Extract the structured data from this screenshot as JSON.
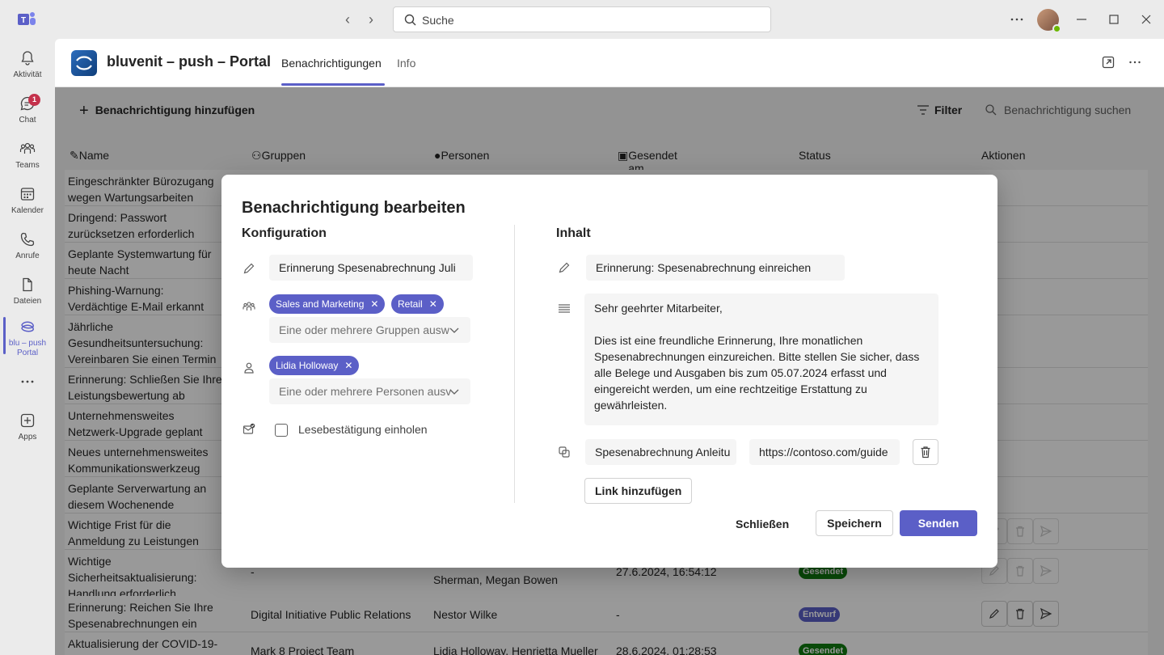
{
  "titlebar": {
    "search_placeholder": "Suche"
  },
  "rail": {
    "items": [
      {
        "label": "Aktivität",
        "icon": "bell-icon"
      },
      {
        "label": "Chat",
        "icon": "chat-icon",
        "badge": "1"
      },
      {
        "label": "Teams",
        "icon": "teams-icon"
      },
      {
        "label": "Kalender",
        "icon": "calendar-icon"
      },
      {
        "label": "Anrufe",
        "icon": "phone-icon"
      },
      {
        "label": "Dateien",
        "icon": "file-icon"
      },
      {
        "label": "blu – push Portal",
        "icon": "bluvenit-icon"
      },
      {
        "label": "Apps",
        "icon": "add-apps-icon"
      }
    ]
  },
  "app": {
    "title": "bluvenit – push – Portal",
    "tabs": [
      "Benachrichtigungen",
      "Info"
    ],
    "active_tab": "Benachrichtigungen"
  },
  "toolbar": {
    "add_label": "Benachrichtigung hinzufügen",
    "filter_label": "Filter",
    "search_placeholder": "Benachrichtigung suchen"
  },
  "table": {
    "columns": [
      "Name",
      "Gruppen",
      "Personen",
      "Gesendet am",
      "Status",
      "Aktionen"
    ],
    "rows": [
      {
        "name": "Eingeschränkter Bürozugang wegen Wartungsarbeiten"
      },
      {
        "name": "Dringend: Passwort zurücksetzen erforderlich"
      },
      {
        "name": "Geplante Systemwartung für heute Nacht"
      },
      {
        "name": "Phishing-Warnung: Verdächtige E-Mail erkannt"
      },
      {
        "name": "Jährliche Gesundheitsuntersuchung: Vereinbaren Sie einen Termin"
      },
      {
        "name": "Erinnerung: Schließen Sie Ihre Leistungsbewertung ab"
      },
      {
        "name": "Unternehmensweites Netzwerk-Upgrade geplant"
      },
      {
        "name": "Neues unternehmensweites Kommunikationswerkzeug"
      },
      {
        "name": "Geplante Serverwartung an diesem Wochenende"
      },
      {
        "name": "Wichtige Frist für die Anmeldung zu Leistungen"
      },
      {
        "name": "Wichtige Sicherheitsaktualisierung: Handlung erforderlich",
        "groups": "-",
        "persons": "Sherman, Megan Bowen",
        "date": "27.6.2024, 16:54:12",
        "status": "Gesendet"
      },
      {
        "name": "Erinnerung: Reichen Sie Ihre Spesenabrechnungen ein",
        "groups": "Digital Initiative Public Relations",
        "persons": "Nestor Wilke",
        "date": "-",
        "status": "Entwurf"
      },
      {
        "name": "Aktualisierung der COVID-19-",
        "groups": "Mark 8 Project Team",
        "persons": "Lidia Holloway, Henrietta Mueller",
        "date": "28.6.2024, 01:28:53",
        "status": "Gesendet"
      }
    ]
  },
  "dialog": {
    "title": "Benachrichtigung bearbeiten",
    "config_title": "Konfiguration",
    "content_title": "Inhalt",
    "name_value": "Erinnerung Spesenabrechnung Juli",
    "groups": [
      "Sales and Marketing",
      "Retail"
    ],
    "groups_placeholder": "Eine oder mehrere Gruppen ausw",
    "persons": [
      "Lidia Holloway"
    ],
    "persons_placeholder": "Eine oder mehrere Personen ausv",
    "read_receipt_label": "Lesebestätigung einholen",
    "subject_value": "Erinnerung: Spesenabrechnung einreichen",
    "body_value": "Sehr geehrter Mitarbeiter,\n\nDies ist eine freundliche Erinnerung, Ihre monatlichen Spesenabrechnungen einzureichen. Bitte stellen Sie sicher, dass alle Belege und Ausgaben bis zum 05.07.2024 erfasst und eingereicht werden, um eine rechtzeitige Erstattung zu gewährleisten.",
    "link_title_value": "Spesenabrechnung Anleitu",
    "link_url_value": "https://contoso.com/guide",
    "add_link_label": "Link hinzufügen",
    "close_label": "Schließen",
    "save_label": "Speichern",
    "send_label": "Senden"
  },
  "colors": {
    "accent": "#5b5fc7",
    "sent": "#107c10",
    "badge": "#c4314b"
  }
}
